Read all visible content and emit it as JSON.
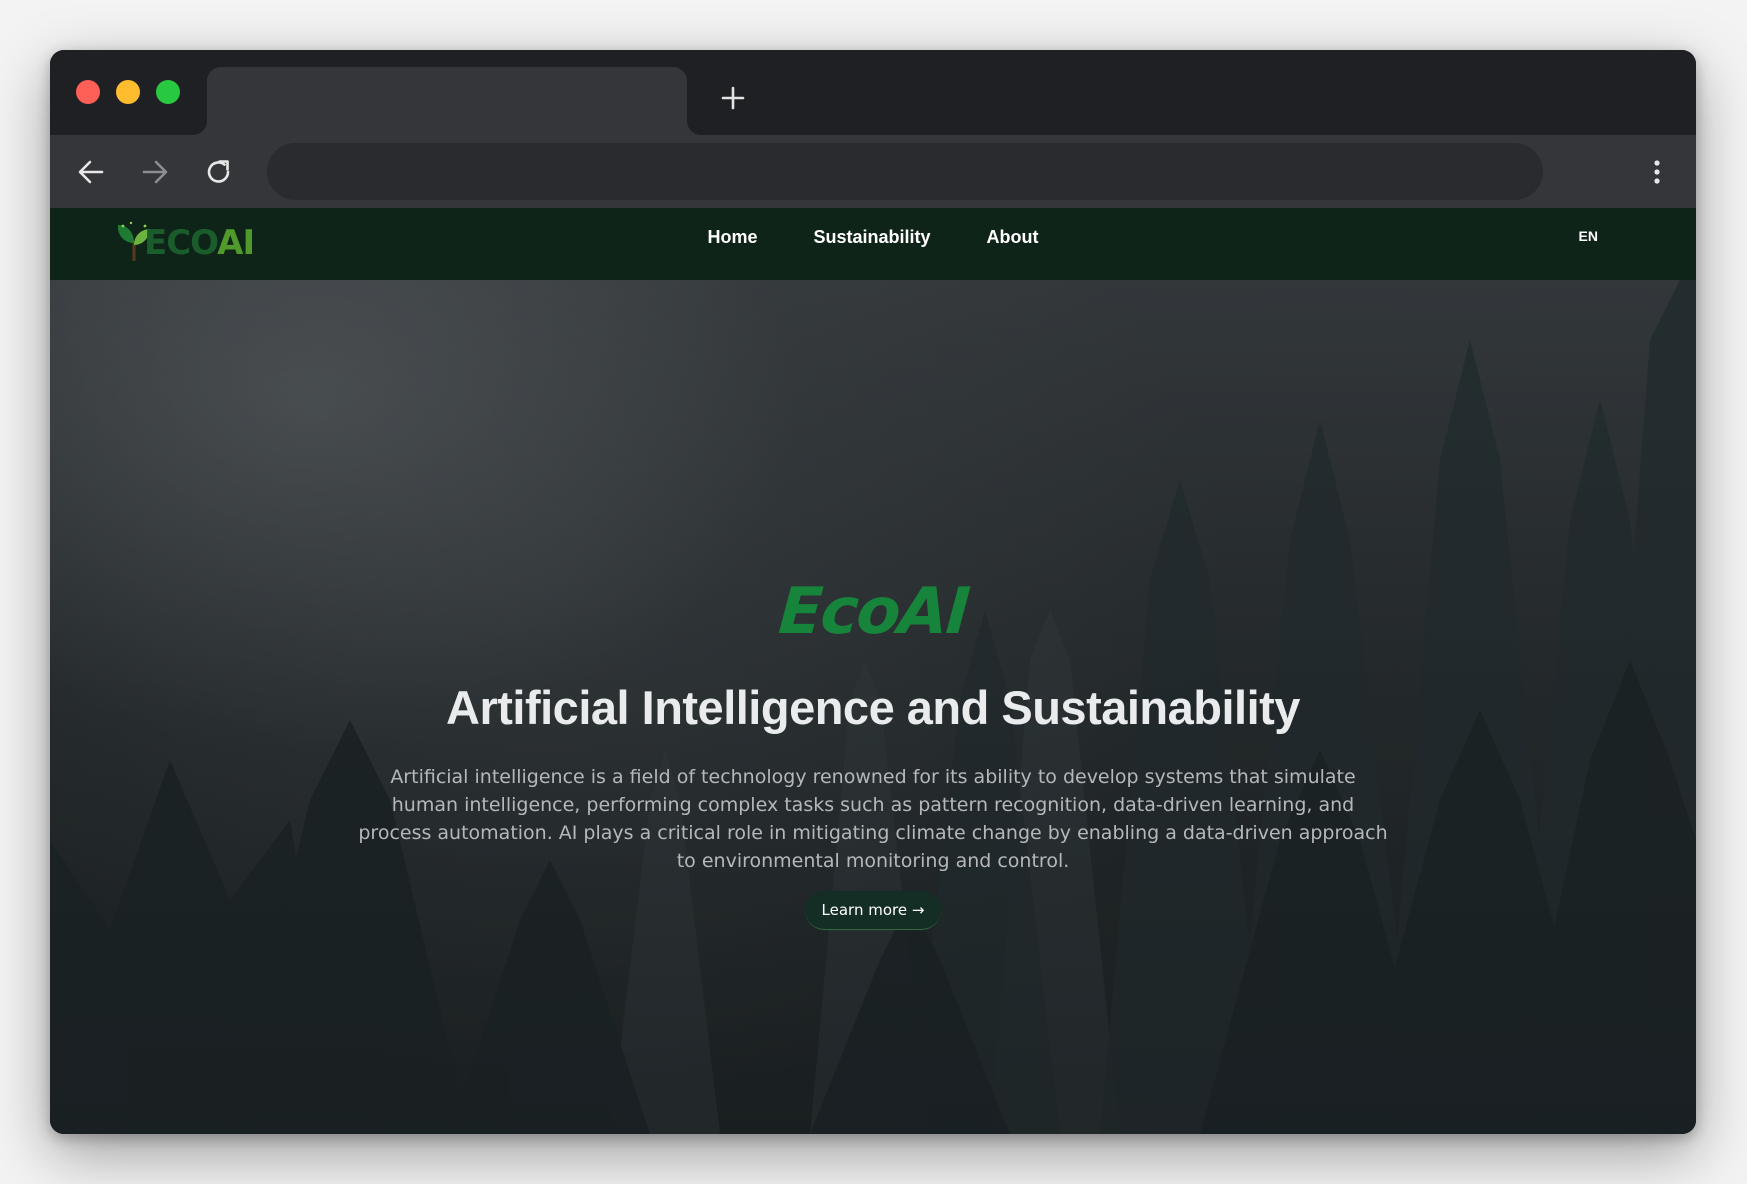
{
  "browser": {
    "tab_title": "",
    "url": "",
    "icons": {
      "new_tab": "plus-icon",
      "back": "arrow-left-icon",
      "forward": "arrow-right-icon",
      "reload": "reload-icon",
      "menu": "kebab-menu-icon"
    },
    "colors": {
      "close": "#fe5f57",
      "minimize": "#febc2e",
      "maximize": "#28c840"
    }
  },
  "site": {
    "logo": {
      "eco": "ECO",
      "ai": "AI",
      "icon": "leaf-sprout-icon"
    },
    "nav": {
      "items": [
        {
          "label": "Home"
        },
        {
          "label": "Sustainability"
        },
        {
          "label": "About"
        }
      ],
      "language": "EN"
    },
    "colors": {
      "nav_background": "#0f2418",
      "brand_green": "#17843b"
    }
  },
  "hero": {
    "brand": "EcoAI",
    "headline": "Artificial Intelligence and Sustainability",
    "description": "Artificial intelligence is a field of technology renowned for its ability to develop systems that simulate human intelligence, performing complex tasks such as pattern recognition, data-driven learning, and process automation. AI plays a critical role in mitigating climate change by enabling a data-driven approach to environmental monitoring and control.",
    "cta_label": "Learn more →"
  }
}
